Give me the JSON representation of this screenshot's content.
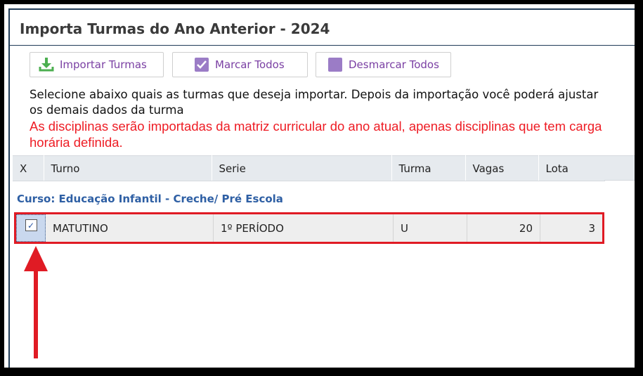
{
  "window": {
    "title": "Importa Turmas do Ano Anterior - 2024"
  },
  "toolbar": {
    "import_label": "Importar Turmas",
    "mark_all_label": "Marcar Todos",
    "unmark_all_label": "Desmarcar Todos",
    "import_icon": "download-icon",
    "mark_icon": "checked-box-icon",
    "unmark_icon": "empty-box-icon"
  },
  "instructions": {
    "text": "Selecione abaixo quais as turmas que deseja importar. Depois da importação você poderá ajustar os demais dados da turma",
    "warning": "As disciplinas serão importadas da matriz curricular do ano atual, apenas disciplinas que tem carga horária definida."
  },
  "table": {
    "columns": [
      "X",
      "Turno",
      "Serie",
      "Turma",
      "Vagas",
      "Lota"
    ],
    "group_label": "Curso: Educação Infantil - Creche/ Pré Escola",
    "rows": [
      {
        "checked": true,
        "turno": "MATUTINO",
        "serie": "1º PERÍODO",
        "turma": "U",
        "vagas": "20",
        "lota": "3"
      }
    ]
  },
  "colors": {
    "accent_purple": "#7a3fa3",
    "warning_red": "#ee1c24",
    "group_blue": "#2e5fa4",
    "highlight_red": "#e01b24"
  }
}
